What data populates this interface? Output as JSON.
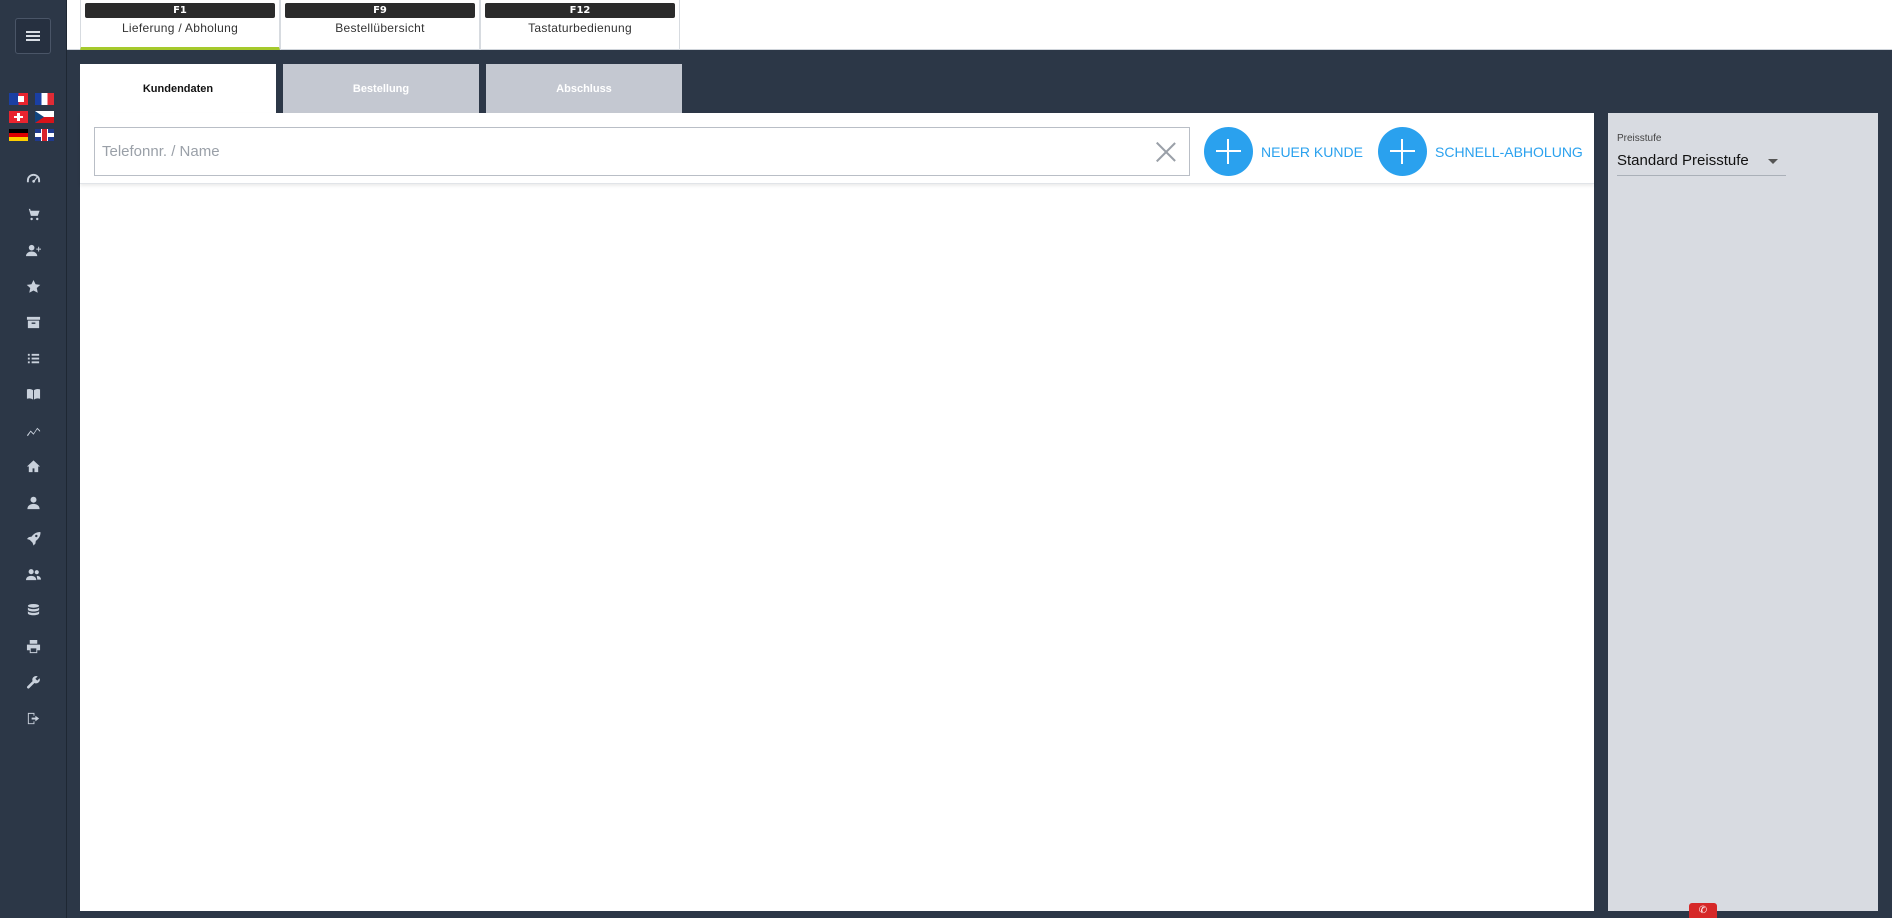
{
  "topbar": {
    "fkeys": [
      {
        "key": "F1",
        "label": "Lieferung / Abholung"
      },
      {
        "key": "F9",
        "label": "Bestellübersicht"
      },
      {
        "key": "F12",
        "label": "Tastaturbedienung"
      }
    ]
  },
  "tabs": [
    {
      "label": "Kundendaten"
    },
    {
      "label": "Bestellung"
    },
    {
      "label": "Abschluss"
    }
  ],
  "search": {
    "placeholder": "Telefonnr. / Name",
    "value": ""
  },
  "actions": {
    "new_customer": "NEUER KUNDE",
    "quick_pickup": "SCHNELL-ABHOLUNG"
  },
  "side": {
    "price_label": "Preisstufe",
    "price_value": "Standard Preisstufe"
  },
  "colors": {
    "accent_blue": "#2aa1ee",
    "sidebar_bg": "#2c3747",
    "active_underline": "#a5c92c",
    "tab_inactive": "#c4c8d1",
    "phone_badge": "#d62828"
  },
  "sidebar": {
    "icons": [
      "dashboard-icon",
      "cart-icon",
      "add-user-icon",
      "star-icon",
      "archive-icon",
      "list-icon",
      "book-icon",
      "chart-icon",
      "home-icon",
      "user-icon",
      "rocket-icon",
      "users-icon",
      "database-icon",
      "printer-icon",
      "wrench-icon",
      "logout-icon"
    ]
  }
}
